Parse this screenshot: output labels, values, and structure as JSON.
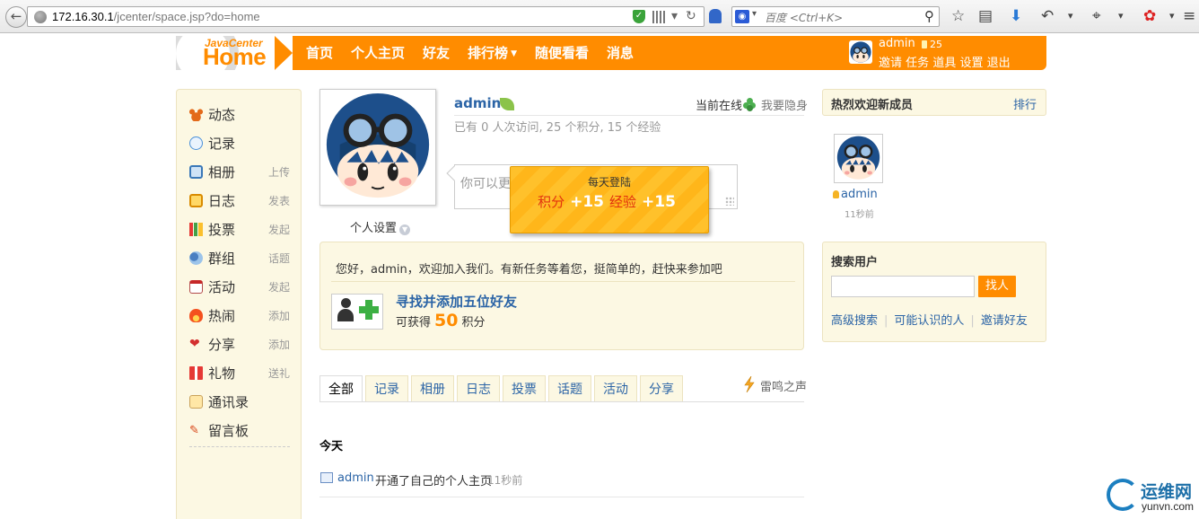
{
  "browser": {
    "url_host": "172.16.30.1",
    "url_path": "/jcenter/space.jsp?do=home",
    "search_placeholder": "百度 <Ctrl+K>"
  },
  "header": {
    "logo_sub": "JavaCenter",
    "logo_main": "Home",
    "nav": [
      "首页",
      "个人主页",
      "好友",
      "排行榜",
      "随便看看",
      "消息"
    ],
    "username": "admin",
    "coins": "25",
    "links": [
      "邀请",
      "任务",
      "道具",
      "设置",
      "退出"
    ],
    "brand_color": "#ff8c00"
  },
  "sidebar": {
    "items": [
      {
        "label": "动态",
        "action": "",
        "icon": "paw-icon"
      },
      {
        "label": "记录",
        "action": "",
        "icon": "speech-bubble-icon"
      },
      {
        "label": "相册",
        "action": "上传",
        "icon": "photo-icon"
      },
      {
        "label": "日志",
        "action": "发表",
        "icon": "journal-icon"
      },
      {
        "label": "投票",
        "action": "发起",
        "icon": "bar-chart-icon"
      },
      {
        "label": "群组",
        "action": "话题",
        "icon": "group-icon"
      },
      {
        "label": "活动",
        "action": "发起",
        "icon": "calendar-icon"
      },
      {
        "label": "热闹",
        "action": "添加",
        "icon": "fire-icon"
      },
      {
        "label": "分享",
        "action": "添加",
        "icon": "heart-share-icon"
      },
      {
        "label": "礼物",
        "action": "送礼",
        "icon": "gift-icon"
      },
      {
        "label": "通讯录",
        "action": "",
        "icon": "address-book-icon"
      },
      {
        "label": "留言板",
        "action": "",
        "icon": "pencil-icon"
      }
    ]
  },
  "profile": {
    "name": "admin",
    "online": "当前在线",
    "hide": "我要隐身",
    "stats": "已有 0 人次访问, 25 个积分, 15 个经验",
    "settings": "个人设置",
    "status_placeholder": "你可以更"
  },
  "daily_login": {
    "title": "每天登陆",
    "points_label": "积分",
    "points_value": "+15",
    "exp_label": "经验",
    "exp_value": "+15"
  },
  "task": {
    "intro": "您好，admin，欢迎加入我们。有新任务等着您，挺简单的，赶快来参加吧",
    "title": "寻找并添加五位好友",
    "earn_prefix": "可获得",
    "earn_value": "50",
    "earn_suffix": "积分"
  },
  "feed": {
    "tabs": [
      "全部",
      "记录",
      "相册",
      "日志",
      "投票",
      "话题",
      "活动",
      "分享"
    ],
    "active_tab": "全部",
    "thunder": "雷鸣之声",
    "day": "今天",
    "items": [
      {
        "user": "admin",
        "text": "开通了自己的个人主页",
        "time": "11秒前"
      }
    ]
  },
  "new_members": {
    "title": "热烈欢迎新成员",
    "rank": "排行",
    "members": [
      {
        "name": "admin",
        "time": "11秒前"
      }
    ]
  },
  "user_search": {
    "title": "搜索用户",
    "button": "找人",
    "links": [
      "高级搜索",
      "可能认识的人",
      "邀请好友"
    ]
  },
  "watermark": {
    "cn": "运维网",
    "en": "yunvn.com"
  }
}
